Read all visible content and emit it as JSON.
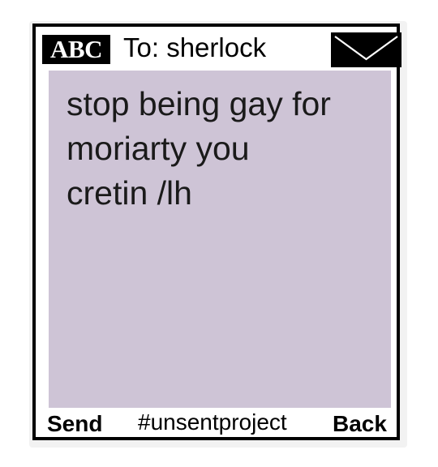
{
  "header": {
    "badge_label": "ABC",
    "recipient": "To: sherlock",
    "envelope_icon": "envelope-icon"
  },
  "message": {
    "text": "stop being gay for\nmoriarty you\ncretin /lh",
    "background": "#cec4d6"
  },
  "footer": {
    "send_label": "Send",
    "hashtag": "#unsentproject",
    "back_label": "Back"
  }
}
